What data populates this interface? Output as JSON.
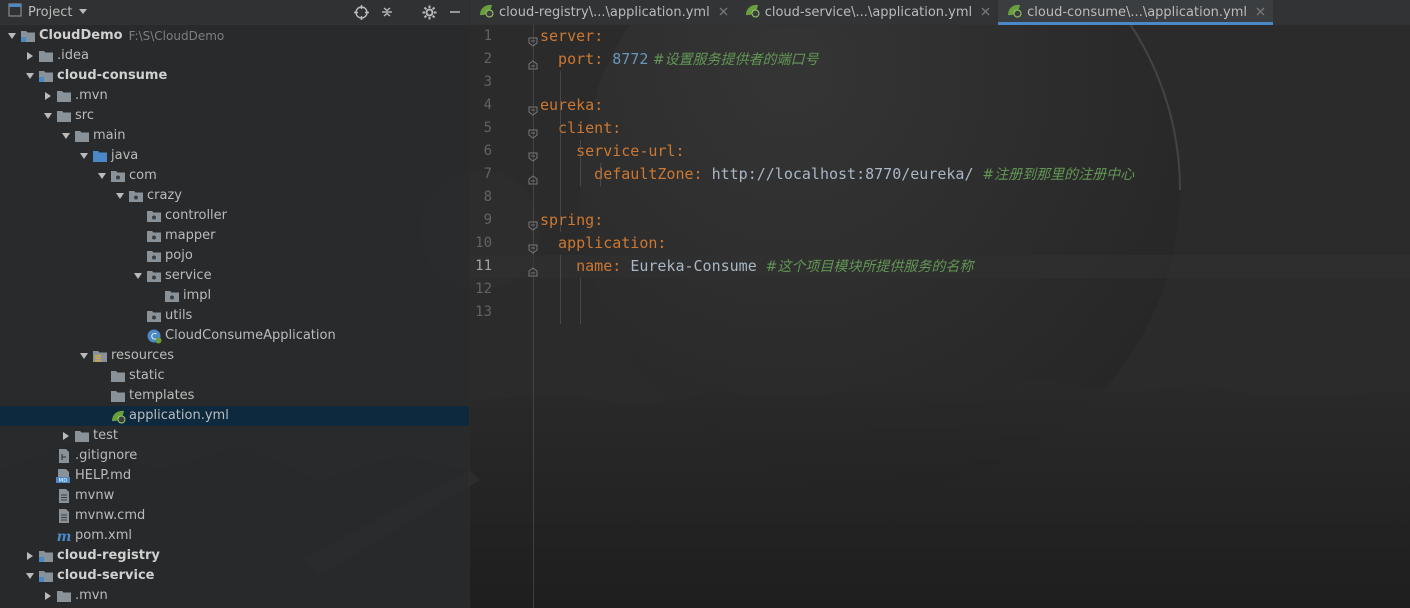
{
  "project_panel": {
    "title": "Project",
    "tree": [
      {
        "label": "CloudDemo",
        "path": "F:\\S\\CloudDemo",
        "icon": "module-folder-icon",
        "bold": true,
        "expanded": true
      },
      {
        "label": ".idea",
        "icon": "folder-icon",
        "expanded": false
      },
      {
        "label": "cloud-consume",
        "icon": "module-folder-icon",
        "bold": true,
        "expanded": true
      },
      {
        "label": ".mvn",
        "icon": "folder-icon",
        "expanded": false
      },
      {
        "label": "src",
        "icon": "folder-icon",
        "expanded": true
      },
      {
        "label": "main",
        "icon": "folder-icon",
        "expanded": true
      },
      {
        "label": "java",
        "icon": "source-folder-icon",
        "expanded": true
      },
      {
        "label": "com",
        "icon": "package-icon",
        "expanded": true
      },
      {
        "label": "crazy",
        "icon": "package-icon",
        "expanded": true
      },
      {
        "label": "controller",
        "icon": "package-icon"
      },
      {
        "label": "mapper",
        "icon": "package-icon"
      },
      {
        "label": "pojo",
        "icon": "package-icon"
      },
      {
        "label": "service",
        "icon": "package-icon",
        "expanded": true
      },
      {
        "label": "impl",
        "icon": "package-icon"
      },
      {
        "label": "utils",
        "icon": "package-icon"
      },
      {
        "label": "CloudConsumeApplication",
        "icon": "spring-boot-class-icon"
      },
      {
        "label": "resources",
        "icon": "resources-folder-icon",
        "expanded": true
      },
      {
        "label": "static",
        "icon": "folder-icon"
      },
      {
        "label": "templates",
        "icon": "folder-icon"
      },
      {
        "label": "application.yml",
        "icon": "spring-yml-icon",
        "selected": true
      },
      {
        "label": "test",
        "icon": "folder-icon",
        "expanded": false
      },
      {
        "label": ".gitignore",
        "icon": "gitignore-file-icon"
      },
      {
        "label": "HELP.md",
        "icon": "markdown-file-icon"
      },
      {
        "label": "mvnw",
        "icon": "text-file-icon"
      },
      {
        "label": "mvnw.cmd",
        "icon": "text-file-icon"
      },
      {
        "label": "pom.xml",
        "icon": "maven-icon"
      },
      {
        "label": "cloud-registry",
        "icon": "module-folder-icon",
        "bold": true,
        "expanded": false
      },
      {
        "label": "cloud-service",
        "icon": "module-folder-icon",
        "bold": true,
        "expanded": true
      },
      {
        "label": ".mvn",
        "icon": "folder-icon",
        "expanded": false
      }
    ]
  },
  "tabs": [
    {
      "label": "cloud-registry\\...\\application.yml",
      "active": false
    },
    {
      "label": "cloud-service\\...\\application.yml",
      "active": false
    },
    {
      "label": "cloud-consume\\...\\application.yml",
      "active": true
    }
  ],
  "editor": {
    "current_line": 11,
    "lines": [
      {
        "n": "1",
        "tokens": [
          {
            "t": "server",
            "c": "k"
          },
          {
            "t": ":",
            "c": "p"
          }
        ]
      },
      {
        "n": "2",
        "tokens": [
          {
            "t": "  port",
            "c": "k"
          },
          {
            "t": ": ",
            "c": "p"
          },
          {
            "t": "8772",
            "c": "n"
          },
          {
            "t": " #设置服务提供者的端口号",
            "c": "c"
          }
        ]
      },
      {
        "n": "3",
        "tokens": []
      },
      {
        "n": "4",
        "tokens": [
          {
            "t": "eureka",
            "c": "k"
          },
          {
            "t": ":",
            "c": "p"
          }
        ]
      },
      {
        "n": "5",
        "tokens": [
          {
            "t": "  client",
            "c": "k"
          },
          {
            "t": ":",
            "c": "p"
          }
        ]
      },
      {
        "n": "6",
        "tokens": [
          {
            "t": "    service-url",
            "c": "k"
          },
          {
            "t": ":",
            "c": "p"
          }
        ]
      },
      {
        "n": "7",
        "tokens": [
          {
            "t": "      defaultZone",
            "c": "k"
          },
          {
            "t": ": ",
            "c": "p"
          },
          {
            "t": "http://localhost:8770/eureka/",
            "c": "s"
          },
          {
            "t": "  #注册到那里的注册中心",
            "c": "c"
          }
        ]
      },
      {
        "n": "8",
        "tokens": []
      },
      {
        "n": "9",
        "tokens": [
          {
            "t": "spring",
            "c": "k"
          },
          {
            "t": ":",
            "c": "p"
          }
        ]
      },
      {
        "n": "10",
        "tokens": [
          {
            "t": "  application",
            "c": "k"
          },
          {
            "t": ":",
            "c": "p"
          }
        ]
      },
      {
        "n": "11",
        "tokens": [
          {
            "t": "    name",
            "c": "k"
          },
          {
            "t": ": ",
            "c": "p"
          },
          {
            "t": "Eureka-Consume",
            "c": "s"
          },
          {
            "t": "  #这个项目模块所提供服务的名称",
            "c": "c"
          }
        ]
      },
      {
        "n": "12",
        "tokens": []
      },
      {
        "n": "13",
        "tokens": []
      }
    ]
  }
}
